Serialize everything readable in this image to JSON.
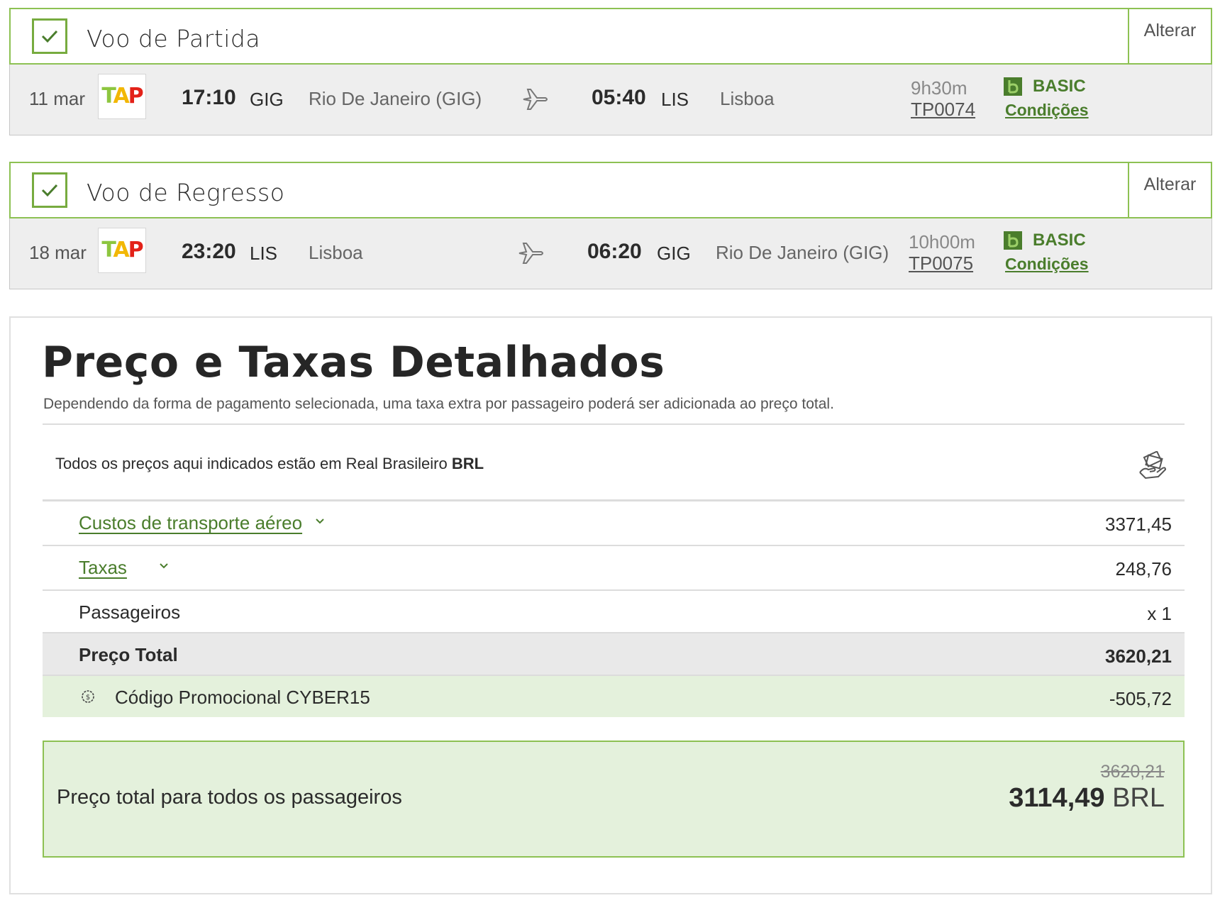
{
  "flights": [
    {
      "title": "Voo de Partida",
      "change_label": "Alterar",
      "date": "11 mar",
      "depart_time": "17:10",
      "depart_code": "GIG",
      "depart_city": "Rio De Janeiro (GIG)",
      "arrive_time": "05:40",
      "arrive_code": "LIS",
      "arrive_city": "Lisboa",
      "duration": "9h30m",
      "flight_number": "TP0074",
      "fare": "BASIC",
      "conditions": "Condições"
    },
    {
      "title": "Voo de Regresso",
      "change_label": "Alterar",
      "date": "18 mar",
      "depart_time": "23:20",
      "depart_code": "LIS",
      "depart_city": "Lisboa",
      "arrive_time": "06:20",
      "arrive_code": "GIG",
      "arrive_city": "Rio De Janeiro (GIG)",
      "duration": "10h00m",
      "flight_number": "TP0075",
      "fare": "BASIC",
      "conditions": "Condições"
    }
  ],
  "airline_logo": {
    "t": "T",
    "a": "A",
    "p": "P"
  },
  "price": {
    "title": "Preço e Taxas Detalhados",
    "subtitle": "Dependendo da forma de pagamento selecionada, uma taxa extra por passageiro poderá ser adicionada ao preço total.",
    "currency_note": "Todos os preços aqui indicados estão em Real Brasileiro",
    "currency_code": "BRL",
    "rows": {
      "transport": {
        "label": "Custos de transporte aéreo",
        "value": "3371,45"
      },
      "taxes": {
        "label": "Taxas",
        "value": "248,76"
      },
      "passengers": {
        "label": "Passageiros",
        "value": "x 1"
      },
      "total": {
        "label": "Preço Total",
        "value": "3620,21"
      },
      "promo": {
        "label": "Código Promocional CYBER15",
        "value": "-505,72"
      }
    },
    "grand": {
      "label": "Preço total para todos os passageiros",
      "old_value": "3620,21",
      "new_value": "3114,49",
      "currency": "BRL"
    }
  },
  "colors": {
    "accent_green": "#8dc153",
    "link_green": "#4a7d2c",
    "promo_bg": "#e4f1dc"
  },
  "icons": [
    "check-icon",
    "plane-icon",
    "basic-fare-icon",
    "money-hand-icon",
    "chevron-down-icon",
    "coin-icon"
  ]
}
